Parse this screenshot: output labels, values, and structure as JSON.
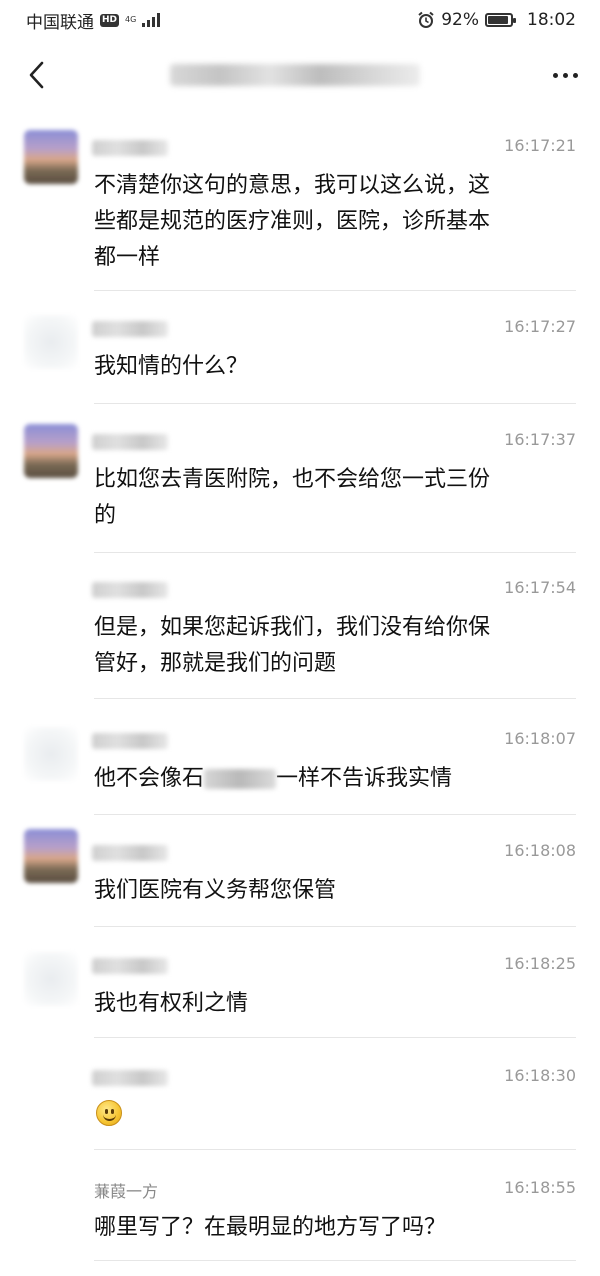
{
  "status_bar": {
    "carrier": "中国联通",
    "hd": "HD",
    "network": "4G",
    "battery": "92%",
    "battery_level": 0.92,
    "time": "18:02"
  },
  "nav": {
    "back_icon": "chevron-left-icon",
    "more_icon": "more-dots-icon"
  },
  "messages": [
    {
      "time": "16:17:21",
      "lines": [
        "不清楚你这句的意思，我可以这么说，这",
        "些都是规范的医疗准则，医院，诊所基本",
        "都一样"
      ]
    },
    {
      "time": "16:17:27",
      "lines": [
        "我知情的什么？"
      ]
    },
    {
      "time": "16:17:37",
      "lines": [
        "比如您去青医附院，也不会给您一式三份",
        "的"
      ]
    },
    {
      "time": "16:17:54",
      "lines": [
        "但是，如果您起诉我们，我们没有给你保",
        "管好，那就是我们的问题"
      ]
    },
    {
      "time": "16:18:07",
      "text_before": "他不会像石",
      "text_after": "一样不告诉我实情"
    },
    {
      "time": "16:18:08",
      "lines": [
        "我们医院有义务帮您保管"
      ]
    },
    {
      "time": "16:18:25",
      "lines": [
        "我也有权利之情"
      ]
    },
    {
      "time": "16:18:30",
      "emoji": "smiley-emoji"
    },
    {
      "time": "16:18:55",
      "sender": "蒹葭一方",
      "lines": [
        "哪里写了？在最明显的地方写了吗？"
      ]
    }
  ]
}
